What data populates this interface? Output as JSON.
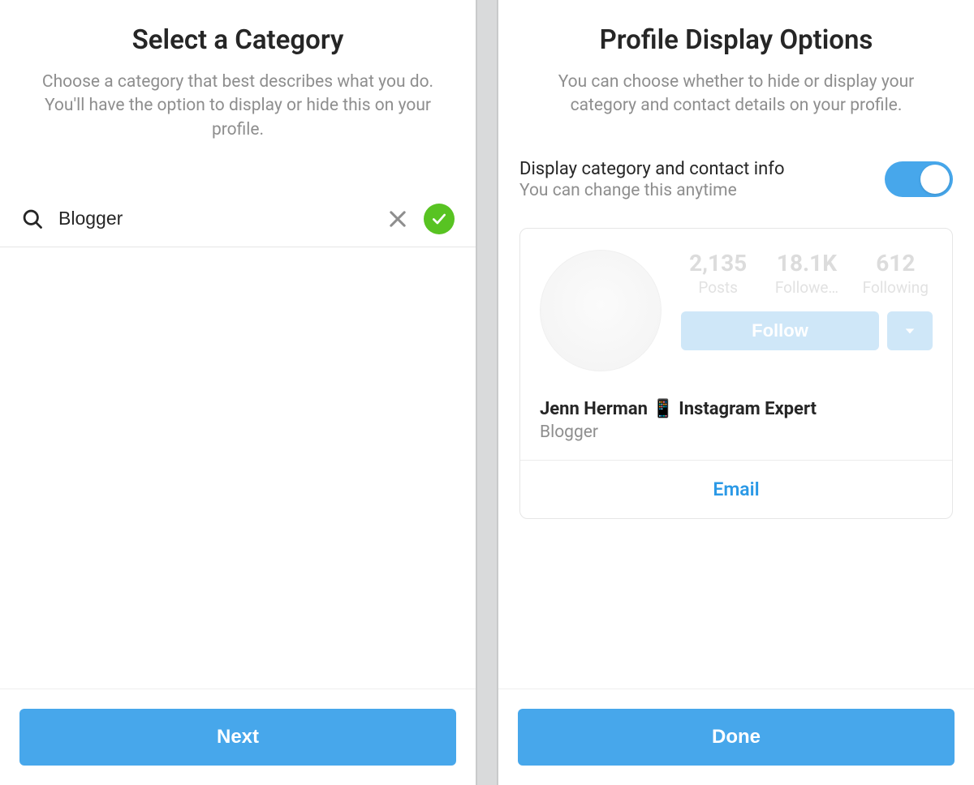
{
  "left": {
    "title": "Select a Category",
    "subtitle": "Choose a category that best describes what you do. You'll have the option to display or hide this on your profile.",
    "search_value": "Blogger",
    "next_button": "Next"
  },
  "right": {
    "title": "Profile Display Options",
    "subtitle": "You can choose whether to hide or display your category and contact details on your profile.",
    "toggle": {
      "label": "Display category and contact info",
      "sublabel": "You can change this anytime",
      "on": true
    },
    "profile": {
      "stats": {
        "posts_value": "2,135",
        "posts_label": "Posts",
        "followers_value": "18.1K",
        "followers_label": "Followe…",
        "following_value": "612",
        "following_label": "Following"
      },
      "follow_button": "Follow",
      "name": "Jenn Herman 📱 Instagram Expert",
      "category": "Blogger",
      "email_button": "Email"
    },
    "done_button": "Done"
  }
}
